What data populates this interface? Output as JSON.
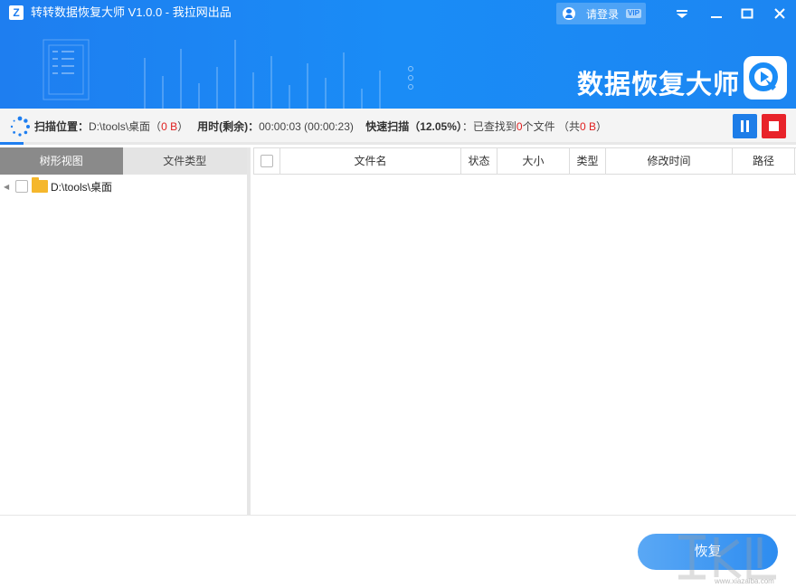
{
  "app": {
    "logo_letter": "Z",
    "title": "转转数据恢复大师 V1.0.0 - 我拉网出品",
    "brand": "数据恢复大师"
  },
  "login": {
    "label": "请登录",
    "badge": "VIP"
  },
  "status": {
    "location_label": "扫描位置：",
    "location_path": "D:\\tools\\桌面",
    "location_size_open": "（",
    "location_size": "0 B",
    "location_size_close": "）",
    "time_label": "用时(剩余)：",
    "time_value": "00:00:03 (00:00:23)",
    "scan_label": "快速扫描（12.05%）",
    "found_prefix": "：已查找到",
    "found_count": "0",
    "found_suffix": "个文件 （共",
    "total_size": "0 B",
    "total_suffix": "）",
    "progress_percent": 3
  },
  "tabs": [
    {
      "label": "树形视图",
      "active": true
    },
    {
      "label": "文件类型",
      "active": false
    }
  ],
  "tree": [
    {
      "label": "D:\\tools\\桌面"
    }
  ],
  "table": {
    "columns": [
      {
        "label": "文件名"
      },
      {
        "label": "状态"
      },
      {
        "label": "大小"
      },
      {
        "label": "类型"
      },
      {
        "label": "修改时间"
      },
      {
        "label": "路径"
      }
    ],
    "rows": []
  },
  "footer": {
    "recover_label": "恢复"
  },
  "watermark": {
    "text": "www.xiazaiba.com"
  },
  "colors": {
    "primary": "#1e7ef0",
    "stop": "#e8232a",
    "alert": "#e02020"
  }
}
